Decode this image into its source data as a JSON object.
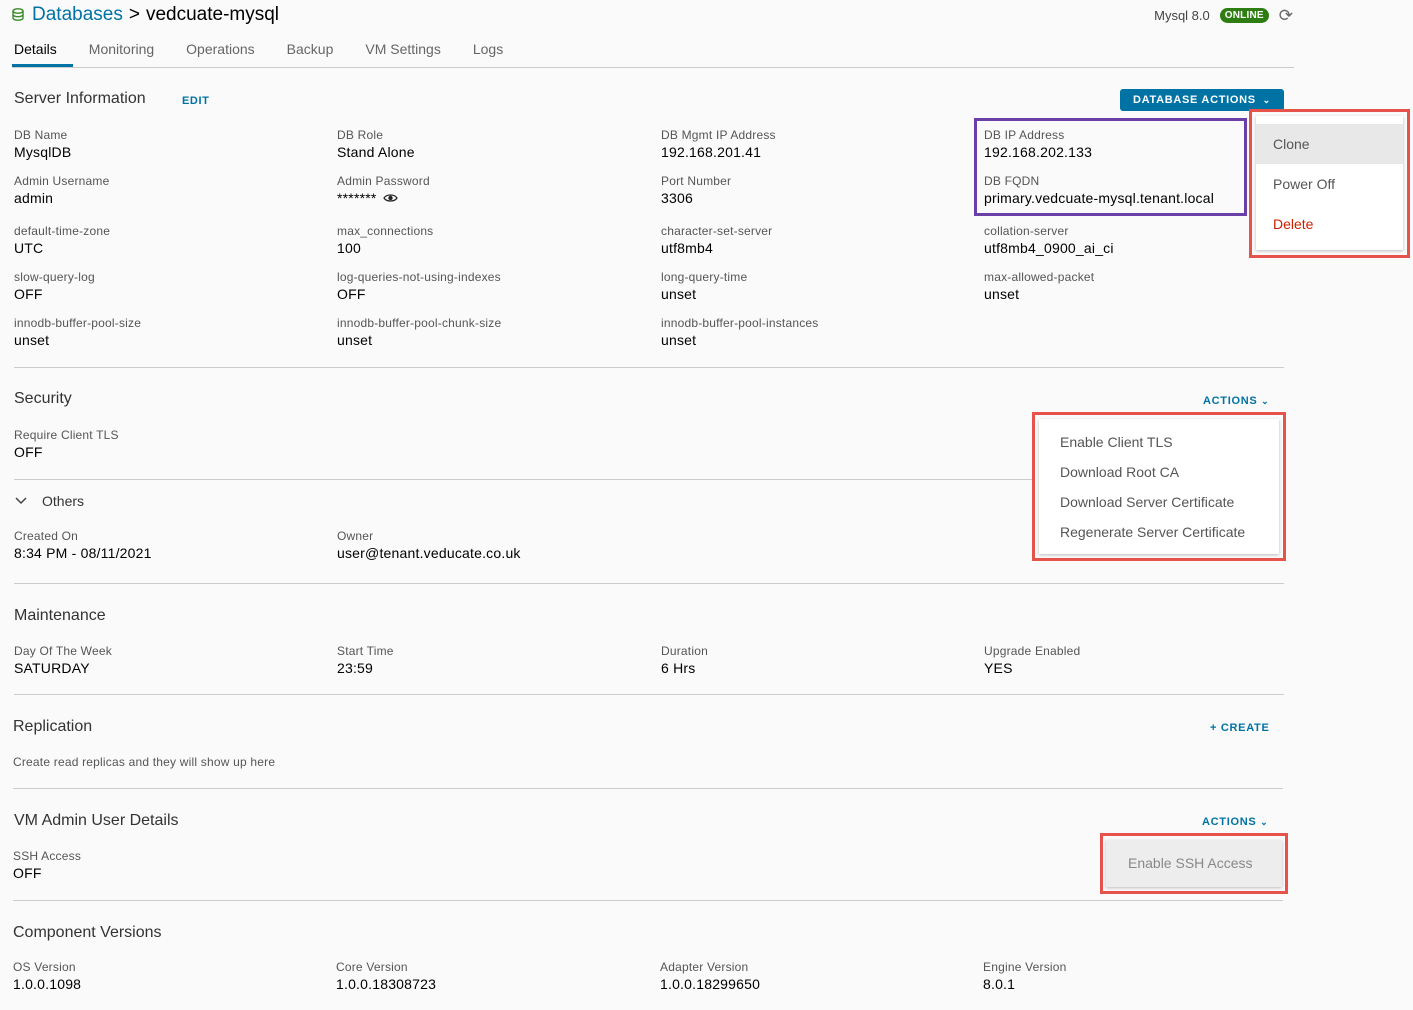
{
  "header": {
    "breadcrumb_root": "Databases",
    "breadcrumb_sep": ">",
    "db_name": "vedcuate-mysql",
    "engine": "Mysql 8.0",
    "status": "ONLINE",
    "refresh_glyph": "⟳"
  },
  "tabs": [
    {
      "label": "Details"
    },
    {
      "label": "Monitoring"
    },
    {
      "label": "Operations"
    },
    {
      "label": "Backup"
    },
    {
      "label": "VM Settings"
    },
    {
      "label": "Logs"
    }
  ],
  "server_info": {
    "title": "Server Information",
    "edit_label": "EDIT",
    "actions_label": "DATABASE ACTIONS",
    "fields": [
      {
        "label": "DB Name",
        "value": "MysqlDB"
      },
      {
        "label": "DB Role",
        "value": "Stand Alone"
      },
      {
        "label": "DB Mgmt IP Address",
        "value": "192.168.201.41"
      },
      {
        "label": "DB IP Address",
        "value": "192.168.202.133"
      },
      {
        "label": "Admin Username",
        "value": "admin"
      },
      {
        "label": "Admin Password",
        "value": "*******"
      },
      {
        "label": "Port Number",
        "value": "3306"
      },
      {
        "label": "DB FQDN",
        "value": "primary.vedcuate-mysql.tenant.local"
      },
      {
        "label": "default-time-zone",
        "value": "UTC"
      },
      {
        "label": "max_connections",
        "value": "100"
      },
      {
        "label": "character-set-server",
        "value": "utf8mb4"
      },
      {
        "label": "collation-server",
        "value": "utf8mb4_0900_ai_ci"
      },
      {
        "label": "slow-query-log",
        "value": "OFF"
      },
      {
        "label": "log-queries-not-using-indexes",
        "value": "OFF"
      },
      {
        "label": "long-query-time",
        "value": "unset"
      },
      {
        "label": "max-allowed-packet",
        "value": "unset"
      },
      {
        "label": "innodb-buffer-pool-size",
        "value": "unset"
      },
      {
        "label": "innodb-buffer-pool-chunk-size",
        "value": "unset"
      },
      {
        "label": "innodb-buffer-pool-instances",
        "value": "unset"
      }
    ]
  },
  "db_actions_menu": [
    {
      "label": "Clone"
    },
    {
      "label": "Power Off"
    },
    {
      "label": "Delete"
    }
  ],
  "security": {
    "title": "Security",
    "actions_label": "ACTIONS",
    "require_tls_label": "Require Client TLS",
    "require_tls_value": "OFF",
    "menu": [
      {
        "label": "Enable Client TLS"
      },
      {
        "label": "Download Root CA"
      },
      {
        "label": "Download Server Certificate"
      },
      {
        "label": "Regenerate Server Certificate"
      }
    ]
  },
  "others": {
    "title": "Others",
    "created_label": "Created On",
    "created_value": "8:34 PM - 08/11/2021",
    "owner_label": "Owner",
    "owner_value": "user@tenant.veducate.co.uk"
  },
  "maintenance": {
    "title": "Maintenance",
    "fields": [
      {
        "label": "Day Of The Week",
        "value": "SATURDAY"
      },
      {
        "label": "Start Time",
        "value": "23:59"
      },
      {
        "label": "Duration",
        "value": "6 Hrs"
      },
      {
        "label": "Upgrade Enabled",
        "value": "YES"
      }
    ]
  },
  "replication": {
    "title": "Replication",
    "create_label": "+ CREATE",
    "hint": "Create read replicas and they will show up here"
  },
  "vm_admin": {
    "title": "VM Admin User Details",
    "actions_label": "ACTIONS",
    "ssh_label": "SSH Access",
    "ssh_value": "OFF",
    "menu_item": "Enable SSH Access"
  },
  "components": {
    "title": "Component Versions",
    "fields": [
      {
        "label": "OS Version",
        "value": "1.0.0.1098"
      },
      {
        "label": "Core Version",
        "value": "1.0.0.18308723"
      },
      {
        "label": "Adapter Version",
        "value": "1.0.0.18299650"
      },
      {
        "label": "Engine Version",
        "value": "8.0.1"
      }
    ]
  },
  "colors": {
    "accent": "#0072a3",
    "online": "#2e7d12",
    "danger": "#c92100",
    "highlight_red": "#e5534b",
    "highlight_purple": "#6a3fa8"
  }
}
